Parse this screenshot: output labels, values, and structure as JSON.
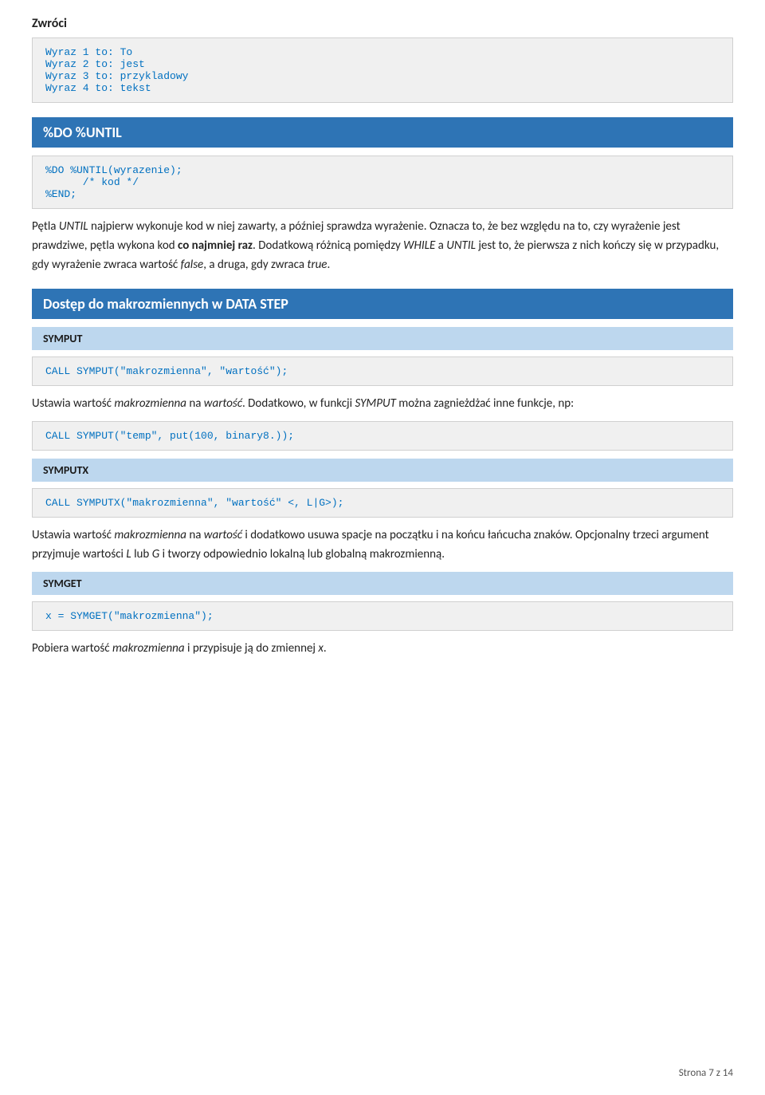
{
  "page": {
    "zwroci_heading": "Zwróci",
    "zwroci_items": [
      "Wyraz 1 to: To",
      "Wyraz 2 to: jest",
      "Wyraz 3 to: przykladowy",
      "Wyraz 4 to: tekst"
    ],
    "do_until_heading": "%DO %UNTIL",
    "do_until_code": "%DO %UNTIL(wyrazenie);\n      /* kod */\n%END;",
    "do_until_prose1": "Pętla UNTIL najpierw wykonuje kod w niej zawarty, a później sprawdza wyrażenie. Oznacza to, że bez względu na to, czy wyrażenie jest prawdziwe, pętla wykona kod co najmniej raz. Dodatkową różnicą pomiędzy WHILE a UNTIL jest to, że pierwsza z nich kończy się w przypadku, gdy wyrażenie zwraca wartość false, a druga, gdy zwraca true.",
    "dostep_heading": "Dostęp do makrozmiennych w DATA STEP",
    "symput_heading": "SYMPUT",
    "symput_code": "CALL SYMPUT(\"makrozmienna\", \"wartość\");",
    "symput_prose": "Ustawia wartość makrozmienna na wartość. Dodatkowo, w funkcji SYMPUT można zagnieżdżać inne funkcje, np:",
    "symput_example_code": "CALL SYMPUT(\"temp\", put(100, binary8.));",
    "symputx_heading": "SYMPUTX",
    "symputx_code": "CALL SYMPUTX(\"makrozmienna\", \"wartość\" <, L|G>);",
    "symputx_prose": "Ustawia wartość makrozmienna na wartość i dodatkowo usuwa spacje na początku i na końcu łańcucha znaków. Opcjonalny trzeci argument przyjmuje wartości L lub G i tworzy odpowiednio lokalną lub globalną makrozmienną.",
    "symget_heading": "SYMGET",
    "symget_code": "x = SYMGET(\"makrozmienna\");",
    "symget_prose": "Pobiera wartość makrozmienna i przypisuje ją do zmiennej x.",
    "footer_text": "Strona 7 z 14"
  }
}
